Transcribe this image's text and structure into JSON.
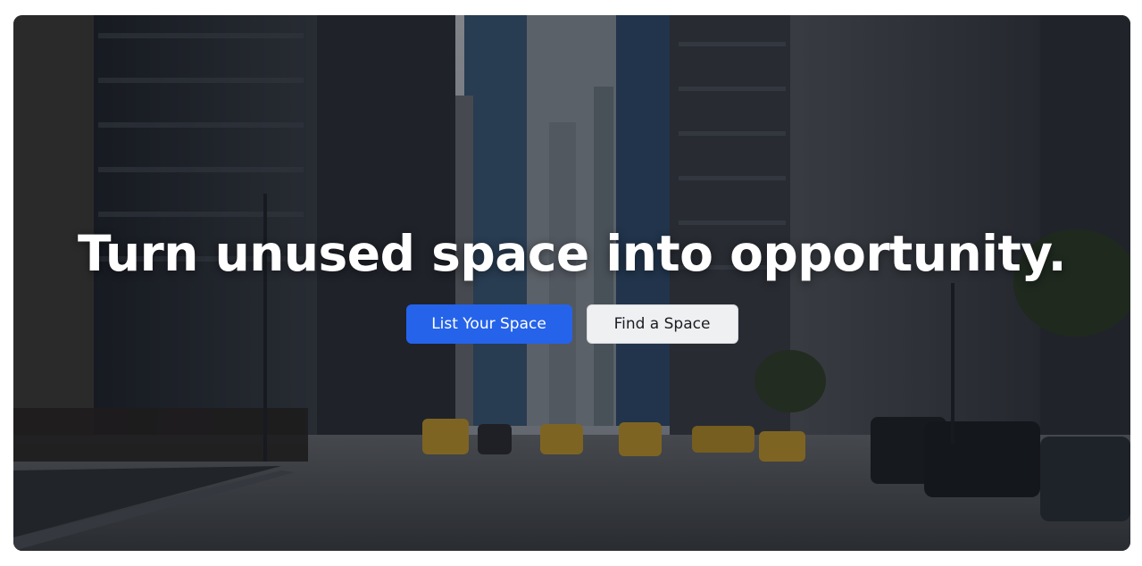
{
  "hero": {
    "headline": "Turn unused space into opportunity.",
    "primary_button_label": "List Your Space",
    "secondary_button_label": "Find a Space"
  },
  "colors": {
    "primary": "#2563eb",
    "secondary_bg": "#eef0f2",
    "headline": "#ffffff"
  }
}
